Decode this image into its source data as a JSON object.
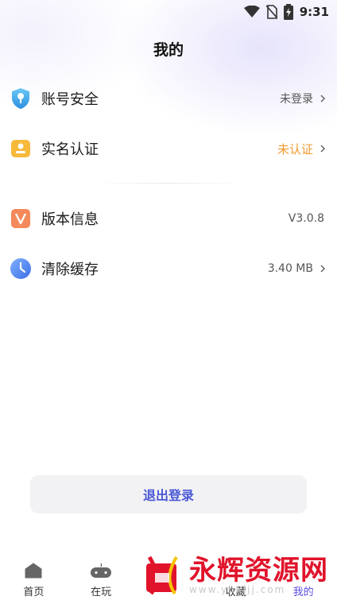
{
  "status_bar": {
    "time": "9:31"
  },
  "page": {
    "title": "我的"
  },
  "menu": [
    {
      "label": "账号安全",
      "value": "未登录",
      "icon": "shield-key-icon"
    },
    {
      "label": "实名认证",
      "value": "未认证",
      "icon": "id-card-icon"
    },
    {
      "label": "版本信息",
      "value": "V3.0.8",
      "icon": "version-v-icon"
    },
    {
      "label": "清除缓存",
      "value": "3.40 MB",
      "icon": "clock-icon"
    }
  ],
  "logout": {
    "label": "退出登录"
  },
  "tabbar": [
    {
      "label": "首页",
      "icon": "home-icon"
    },
    {
      "label": "在玩",
      "icon": "gamepad-icon"
    },
    {
      "label": "",
      "icon": "center-tab-icon"
    },
    {
      "label": "收藏",
      "icon": "favorite-icon"
    },
    {
      "label": "我的",
      "icon": "profile-icon"
    }
  ],
  "watermark": {
    "title": "永辉资源网",
    "url": "www.yhkjjj.com"
  },
  "colors": {
    "accent": "#4a58d6",
    "warning": "#f29a2e",
    "watermark_red": "#e0132b"
  }
}
